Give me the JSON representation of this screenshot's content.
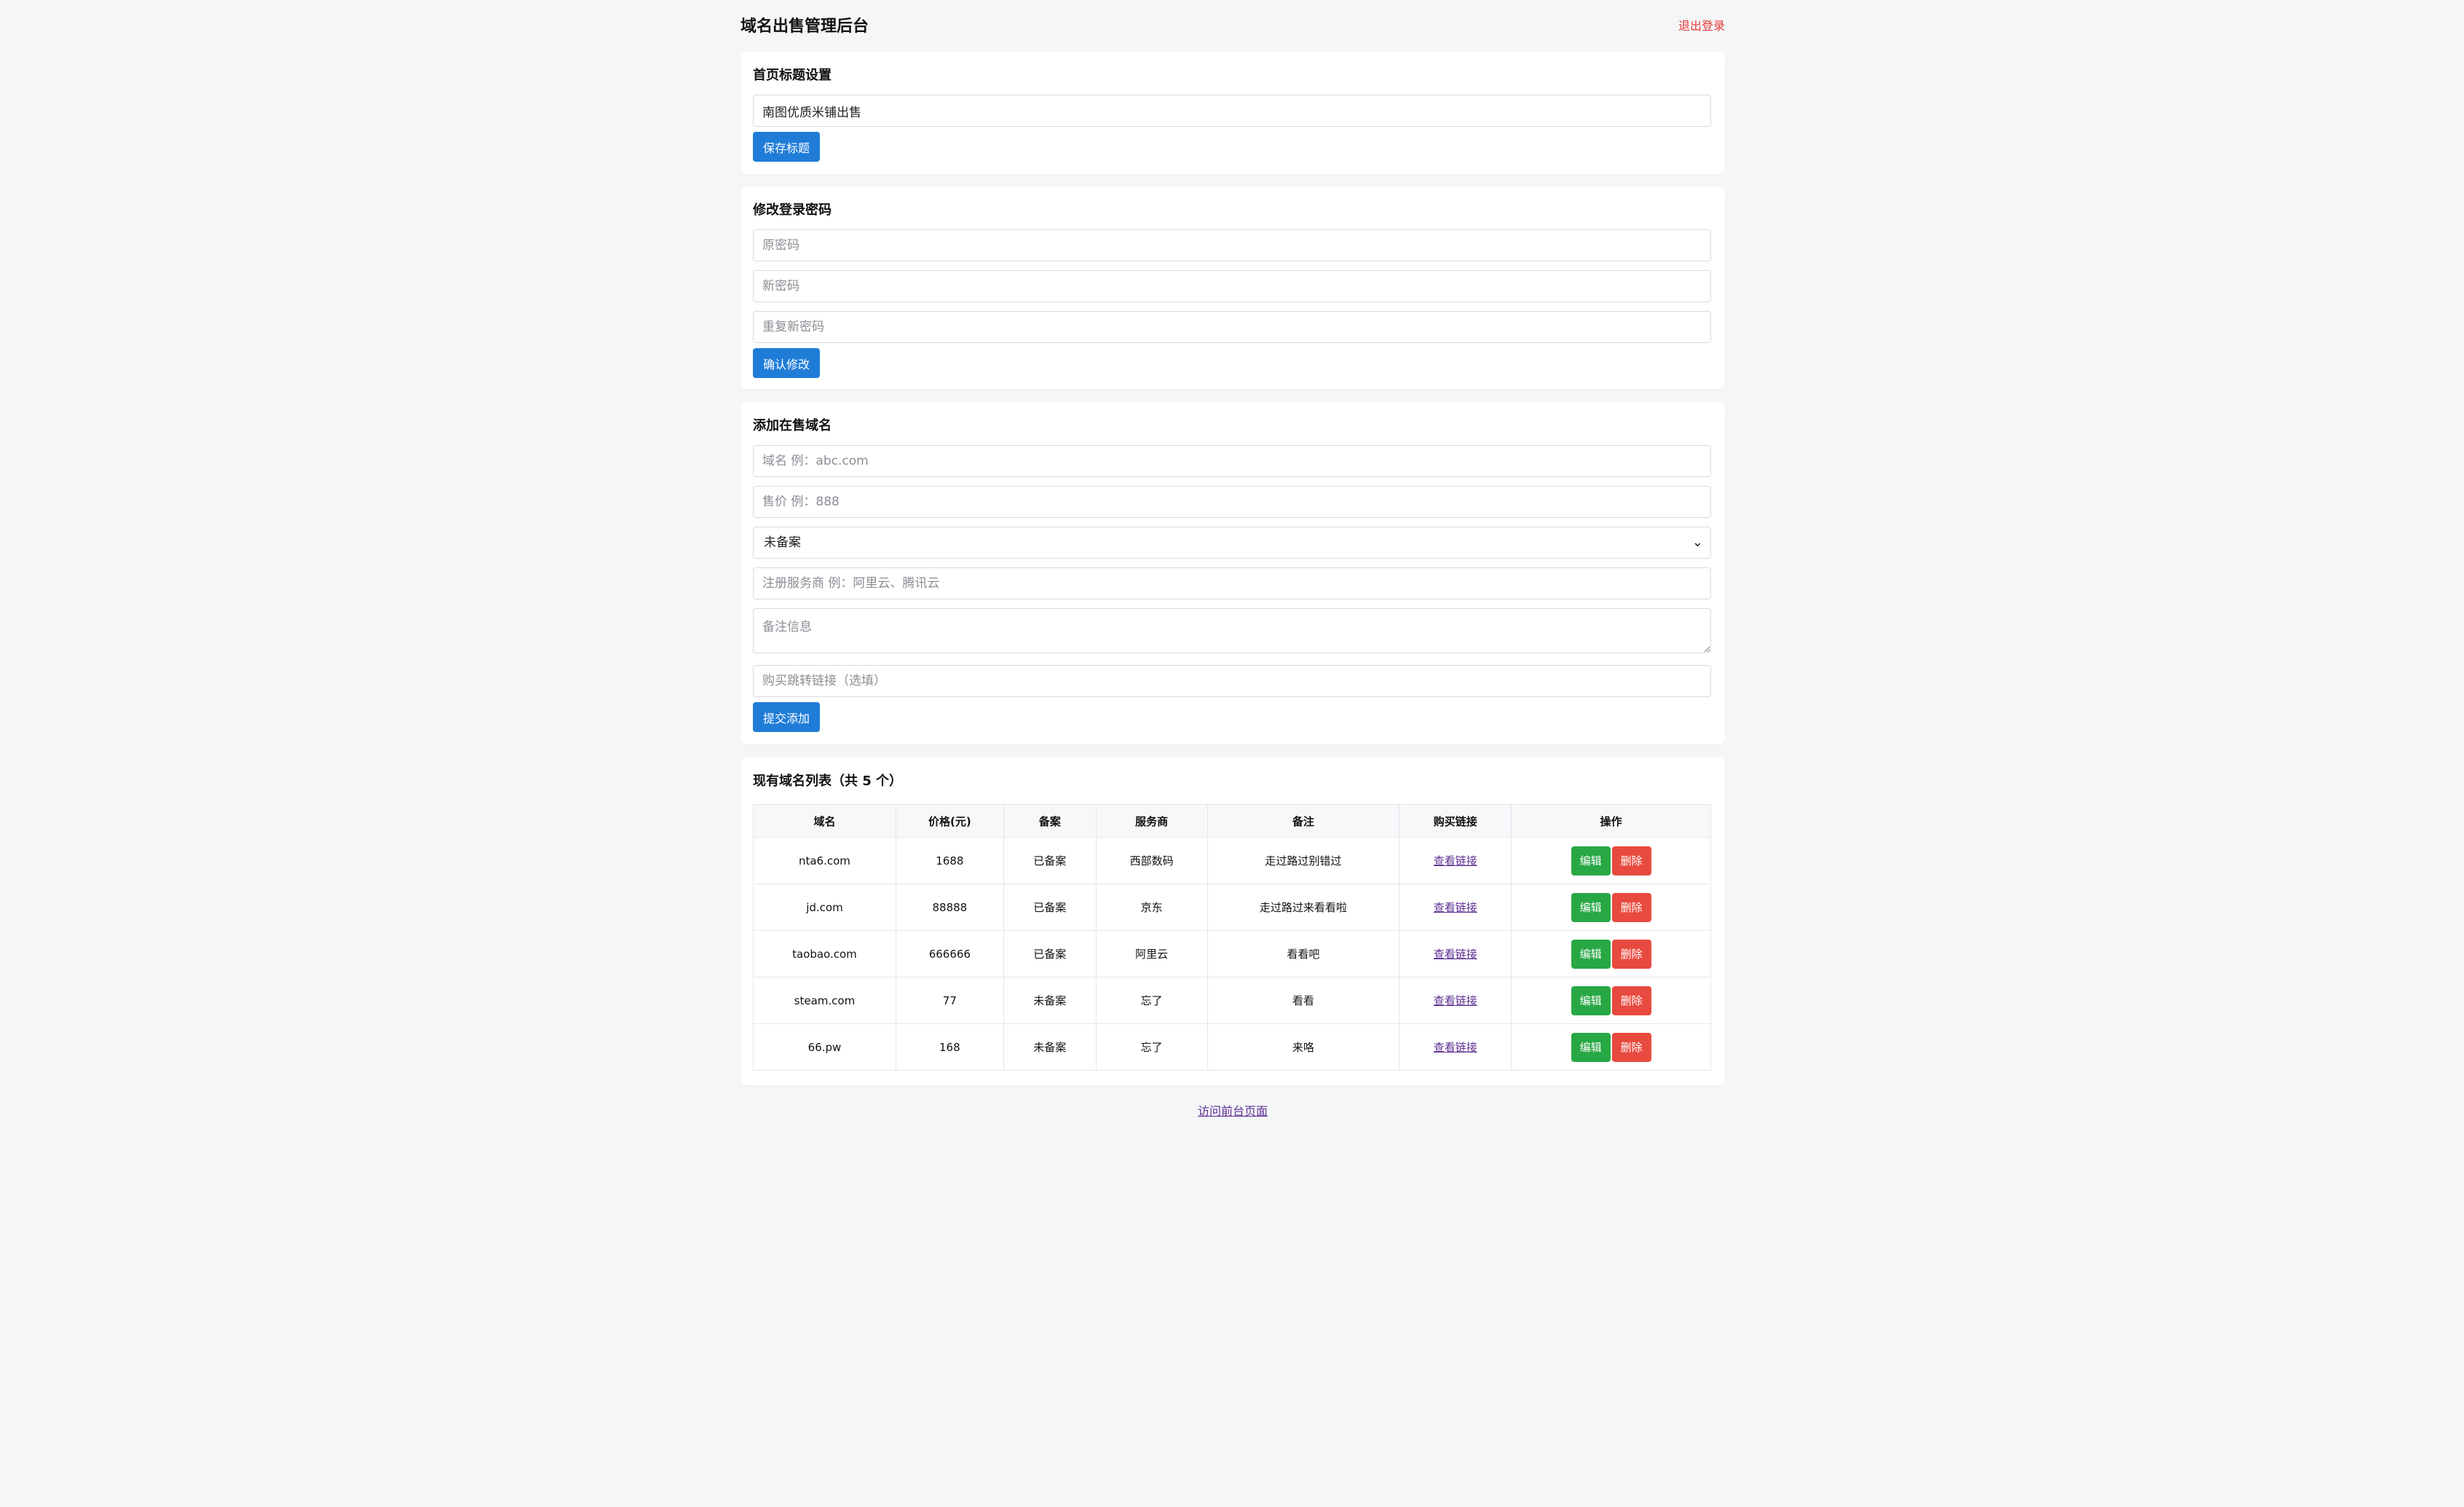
{
  "header": {
    "title": "域名出售管理后台",
    "logout": "退出登录"
  },
  "title_settings": {
    "heading": "首页标题设置",
    "value": "南图优质米铺出售",
    "save_label": "保存标题"
  },
  "password": {
    "heading": "修改登录密码",
    "old_placeholder": "原密码",
    "new_placeholder": "新密码",
    "repeat_placeholder": "重复新密码",
    "confirm_label": "确认修改"
  },
  "add_domain": {
    "heading": "添加在售域名",
    "domain_placeholder": "域名 例：abc.com",
    "price_placeholder": "售价 例：888",
    "icp_selected": "未备案",
    "registrar_placeholder": "注册服务商 例：阿里云、腾讯云",
    "note_placeholder": "备注信息",
    "link_placeholder": "购买跳转链接（选填）",
    "submit_label": "提交添加"
  },
  "domain_list": {
    "heading": "现有域名列表（共 5 个）",
    "columns": [
      "域名",
      "价格(元)",
      "备案",
      "服务商",
      "备注",
      "购买链接",
      "操作"
    ],
    "rows": [
      {
        "domain": "nta6.com",
        "price": "1688",
        "icp": "已备案",
        "registrar": "西部数码",
        "note": "走过路过别错过",
        "link": "查看链接",
        "edit": "编辑",
        "delete": "删除"
      },
      {
        "domain": "jd.com",
        "price": "88888",
        "icp": "已备案",
        "registrar": "京东",
        "note": "走过路过来看看啦",
        "link": "查看链接",
        "edit": "编辑",
        "delete": "删除"
      },
      {
        "domain": "taobao.com",
        "price": "666666",
        "icp": "已备案",
        "registrar": "阿里云",
        "note": "看看吧",
        "link": "查看链接",
        "edit": "编辑",
        "delete": "删除"
      },
      {
        "domain": "steam.com",
        "price": "77",
        "icp": "未备案",
        "registrar": "忘了",
        "note": "看看",
        "link": "查看链接",
        "edit": "编辑",
        "delete": "删除"
      },
      {
        "domain": "66.pw",
        "price": "168",
        "icp": "未备案",
        "registrar": "忘了",
        "note": "来咯",
        "link": "查看链接",
        "edit": "编辑",
        "delete": "删除"
      }
    ]
  },
  "footer": {
    "link": "访问前台页面"
  },
  "colors": {
    "primary": "#1f7dd8",
    "success": "#28a745",
    "danger": "#e84a3f",
    "logout": "#e53935",
    "background": "#f5f6f8"
  }
}
